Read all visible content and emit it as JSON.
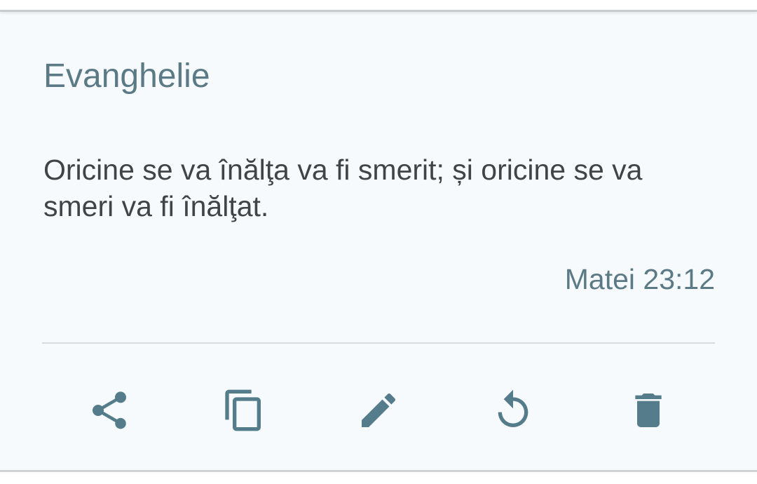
{
  "card": {
    "title": "Evanghelie",
    "verse": "Oricine se va înălţa va fi smerit; și oricine se va smeri va fi înălţat.",
    "reference": "Matei 23:12"
  },
  "actions": [
    {
      "icon": "share-icon"
    },
    {
      "icon": "copy-icon"
    },
    {
      "icon": "edit-icon"
    },
    {
      "icon": "reset-icon"
    },
    {
      "icon": "delete-icon"
    }
  ],
  "colors": {
    "accent": "#5b7a86",
    "icon": "#547c8b",
    "text": "#404447",
    "background": "#f6fafd"
  }
}
